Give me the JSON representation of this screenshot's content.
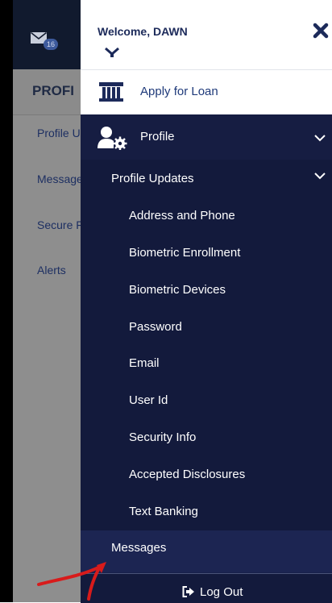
{
  "background_page": {
    "message_count": "16",
    "title": "PROFI",
    "links": [
      "Profile U",
      "Message",
      "Secure F",
      "Alerts"
    ]
  },
  "drawer": {
    "welcome": "Welcome, DAWN",
    "apply_loan": "Apply for Loan",
    "profile": "Profile",
    "profile_updates": "Profile Updates",
    "items": [
      "Address and Phone",
      "Biometric Enrollment",
      "Biometric Devices",
      "Password",
      "Email",
      "User Id",
      "Security Info",
      "Accepted Disclosures",
      "Text Banking"
    ],
    "messages": "Messages",
    "logout": "Log Out"
  },
  "colors": {
    "drawer_bg": "#131a3c",
    "accent_text": "#1f3a7a",
    "annotation_arrow": "#d81b1b"
  },
  "icons": [
    "mail-icon",
    "close-icon",
    "bank-icon",
    "user-gear-icon",
    "chevron-down-icon",
    "logout-icon"
  ]
}
